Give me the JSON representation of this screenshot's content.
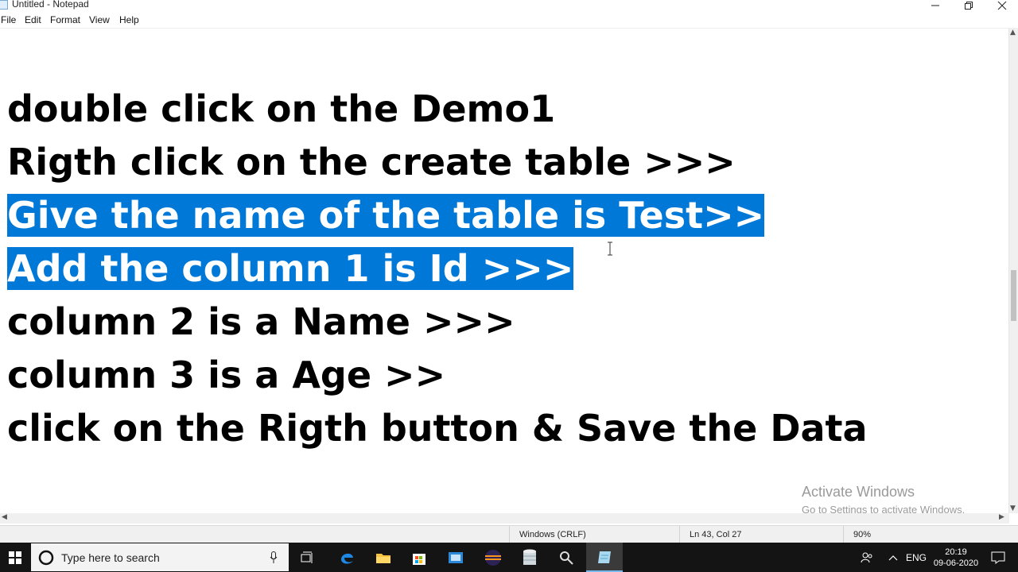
{
  "window": {
    "title": "Untitled - Notepad"
  },
  "menu": [
    "File",
    "Edit",
    "Format",
    "View",
    "Help"
  ],
  "editor": {
    "lines": [
      "double click on the Demo1",
      "Rigth click on the create table >>>",
      "Give the name of the table is Test>>",
      "Add the column 1 is Id >>>",
      "column 2 is a Name >>>",
      "column 3 is a Age >>",
      "click on the Rigth button & Save the Data"
    ],
    "selected_lines": [
      2,
      3
    ]
  },
  "status": {
    "line_ending": "Windows (CRLF)",
    "position": "Ln 43, Col 27",
    "zoom": "90%"
  },
  "watermark": {
    "title": "Activate Windows",
    "subtitle": "Go to Settings to activate Windows."
  },
  "taskbar": {
    "search_placeholder": "Type here to search",
    "apps": [
      "task-view",
      "edge",
      "file-explorer",
      "store",
      "mail",
      "eclipse",
      "database",
      "search-tool",
      "notepad"
    ],
    "tray": {
      "language": "ENG",
      "time": "20:19",
      "date": "09-06-2020"
    }
  },
  "colors": {
    "selection": "#0078d7",
    "taskbar": "#141414"
  }
}
